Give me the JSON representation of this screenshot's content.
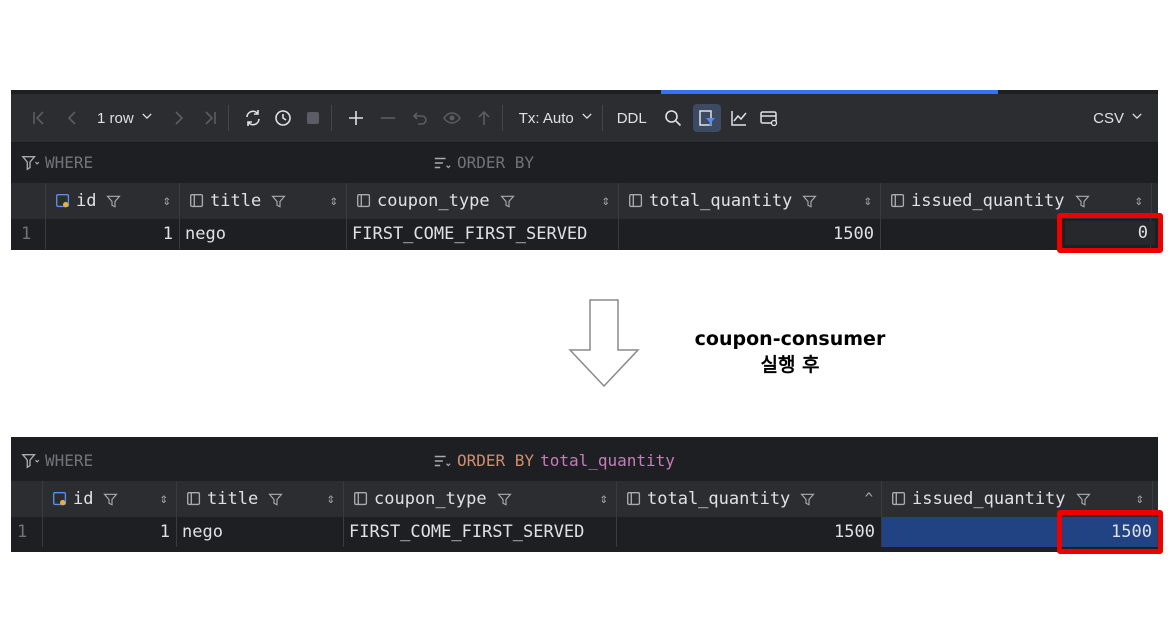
{
  "toolbar": {
    "rows_label": "1 row",
    "tx_label": "Tx: Auto",
    "ddl_label": "DDL",
    "export_label": "CSV"
  },
  "filter": {
    "where_label": "WHERE",
    "orderby_label": "ORDER BY",
    "orderby_column_after": "total_quantity"
  },
  "columns": [
    "id",
    "title",
    "coupon_type",
    "total_quantity",
    "issued_quantity"
  ],
  "before": {
    "row_number": "1",
    "values": [
      "1",
      "nego",
      "FIRST_COME_FIRST_SERVED",
      "1500",
      "0"
    ]
  },
  "after": {
    "row_number": "1",
    "values": [
      "1",
      "nego",
      "FIRST_COME_FIRST_SERVED",
      "1500",
      "1500"
    ]
  },
  "caption": {
    "line1": "coupon-consumer",
    "line2": "실행 후"
  },
  "colors": {
    "highlight": "#ee0000",
    "orderby_keyword": "#cf8e6d",
    "orderby_column": "#c77dbb",
    "selection": "#214283"
  }
}
